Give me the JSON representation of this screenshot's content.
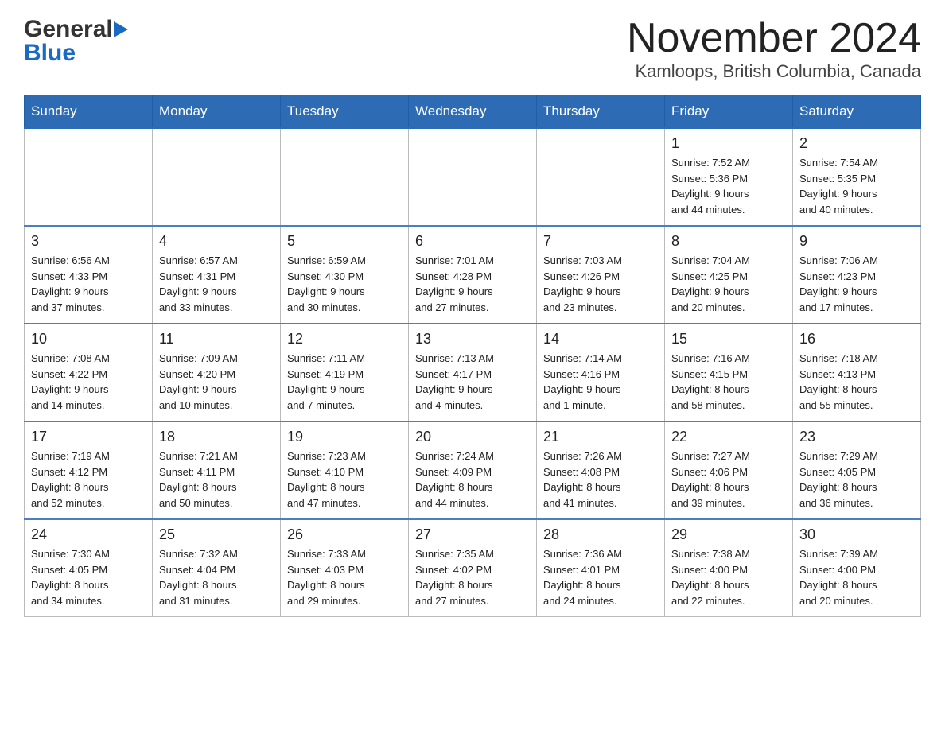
{
  "header": {
    "logo_general": "General",
    "logo_blue": "Blue",
    "month_year": "November 2024",
    "location": "Kamloops, British Columbia, Canada"
  },
  "weekdays": [
    "Sunday",
    "Monday",
    "Tuesday",
    "Wednesday",
    "Thursday",
    "Friday",
    "Saturday"
  ],
  "weeks": [
    {
      "days": [
        {
          "number": "",
          "info": ""
        },
        {
          "number": "",
          "info": ""
        },
        {
          "number": "",
          "info": ""
        },
        {
          "number": "",
          "info": ""
        },
        {
          "number": "",
          "info": ""
        },
        {
          "number": "1",
          "info": "Sunrise: 7:52 AM\nSunset: 5:36 PM\nDaylight: 9 hours\nand 44 minutes."
        },
        {
          "number": "2",
          "info": "Sunrise: 7:54 AM\nSunset: 5:35 PM\nDaylight: 9 hours\nand 40 minutes."
        }
      ]
    },
    {
      "days": [
        {
          "number": "3",
          "info": "Sunrise: 6:56 AM\nSunset: 4:33 PM\nDaylight: 9 hours\nand 37 minutes."
        },
        {
          "number": "4",
          "info": "Sunrise: 6:57 AM\nSunset: 4:31 PM\nDaylight: 9 hours\nand 33 minutes."
        },
        {
          "number": "5",
          "info": "Sunrise: 6:59 AM\nSunset: 4:30 PM\nDaylight: 9 hours\nand 30 minutes."
        },
        {
          "number": "6",
          "info": "Sunrise: 7:01 AM\nSunset: 4:28 PM\nDaylight: 9 hours\nand 27 minutes."
        },
        {
          "number": "7",
          "info": "Sunrise: 7:03 AM\nSunset: 4:26 PM\nDaylight: 9 hours\nand 23 minutes."
        },
        {
          "number": "8",
          "info": "Sunrise: 7:04 AM\nSunset: 4:25 PM\nDaylight: 9 hours\nand 20 minutes."
        },
        {
          "number": "9",
          "info": "Sunrise: 7:06 AM\nSunset: 4:23 PM\nDaylight: 9 hours\nand 17 minutes."
        }
      ]
    },
    {
      "days": [
        {
          "number": "10",
          "info": "Sunrise: 7:08 AM\nSunset: 4:22 PM\nDaylight: 9 hours\nand 14 minutes."
        },
        {
          "number": "11",
          "info": "Sunrise: 7:09 AM\nSunset: 4:20 PM\nDaylight: 9 hours\nand 10 minutes."
        },
        {
          "number": "12",
          "info": "Sunrise: 7:11 AM\nSunset: 4:19 PM\nDaylight: 9 hours\nand 7 minutes."
        },
        {
          "number": "13",
          "info": "Sunrise: 7:13 AM\nSunset: 4:17 PM\nDaylight: 9 hours\nand 4 minutes."
        },
        {
          "number": "14",
          "info": "Sunrise: 7:14 AM\nSunset: 4:16 PM\nDaylight: 9 hours\nand 1 minute."
        },
        {
          "number": "15",
          "info": "Sunrise: 7:16 AM\nSunset: 4:15 PM\nDaylight: 8 hours\nand 58 minutes."
        },
        {
          "number": "16",
          "info": "Sunrise: 7:18 AM\nSunset: 4:13 PM\nDaylight: 8 hours\nand 55 minutes."
        }
      ]
    },
    {
      "days": [
        {
          "number": "17",
          "info": "Sunrise: 7:19 AM\nSunset: 4:12 PM\nDaylight: 8 hours\nand 52 minutes."
        },
        {
          "number": "18",
          "info": "Sunrise: 7:21 AM\nSunset: 4:11 PM\nDaylight: 8 hours\nand 50 minutes."
        },
        {
          "number": "19",
          "info": "Sunrise: 7:23 AM\nSunset: 4:10 PM\nDaylight: 8 hours\nand 47 minutes."
        },
        {
          "number": "20",
          "info": "Sunrise: 7:24 AM\nSunset: 4:09 PM\nDaylight: 8 hours\nand 44 minutes."
        },
        {
          "number": "21",
          "info": "Sunrise: 7:26 AM\nSunset: 4:08 PM\nDaylight: 8 hours\nand 41 minutes."
        },
        {
          "number": "22",
          "info": "Sunrise: 7:27 AM\nSunset: 4:06 PM\nDaylight: 8 hours\nand 39 minutes."
        },
        {
          "number": "23",
          "info": "Sunrise: 7:29 AM\nSunset: 4:05 PM\nDaylight: 8 hours\nand 36 minutes."
        }
      ]
    },
    {
      "days": [
        {
          "number": "24",
          "info": "Sunrise: 7:30 AM\nSunset: 4:05 PM\nDaylight: 8 hours\nand 34 minutes."
        },
        {
          "number": "25",
          "info": "Sunrise: 7:32 AM\nSunset: 4:04 PM\nDaylight: 8 hours\nand 31 minutes."
        },
        {
          "number": "26",
          "info": "Sunrise: 7:33 AM\nSunset: 4:03 PM\nDaylight: 8 hours\nand 29 minutes."
        },
        {
          "number": "27",
          "info": "Sunrise: 7:35 AM\nSunset: 4:02 PM\nDaylight: 8 hours\nand 27 minutes."
        },
        {
          "number": "28",
          "info": "Sunrise: 7:36 AM\nSunset: 4:01 PM\nDaylight: 8 hours\nand 24 minutes."
        },
        {
          "number": "29",
          "info": "Sunrise: 7:38 AM\nSunset: 4:00 PM\nDaylight: 8 hours\nand 22 minutes."
        },
        {
          "number": "30",
          "info": "Sunrise: 7:39 AM\nSunset: 4:00 PM\nDaylight: 8 hours\nand 20 minutes."
        }
      ]
    }
  ]
}
